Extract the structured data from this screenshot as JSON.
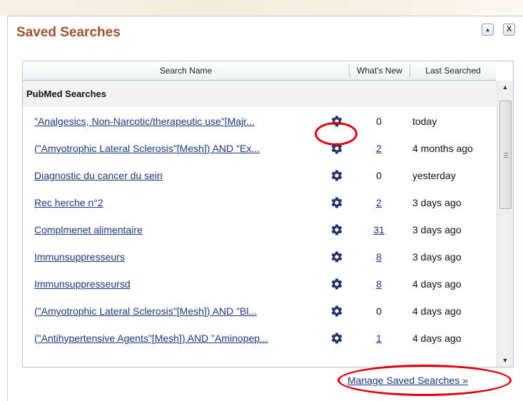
{
  "panel": {
    "title": "Saved Searches",
    "collapse_icon": "triangle-up-icon",
    "close_icon": "close-x-icon",
    "collapse_glyph": "▲",
    "close_glyph": "X"
  },
  "table": {
    "columns": [
      "Search Name",
      "What's New",
      "Last Searched"
    ],
    "group_label": "PubMed Searches",
    "settings_icon": "gear-icon",
    "rows": [
      {
        "name": "\"Analgesics, Non-Narcotic/therapeutic use\"[Majr...",
        "whats_new": "0",
        "whats_new_link": false,
        "last": "today"
      },
      {
        "name": "(\"Amyotrophic Lateral Sclerosis\"[Mesh]) AND \"Ex...",
        "whats_new": "2",
        "whats_new_link": true,
        "last": "4 months ago"
      },
      {
        "name": "Diagnostic du cancer du sein",
        "whats_new": "0",
        "whats_new_link": false,
        "last": "yesterday"
      },
      {
        "name": "Rec herche n°2",
        "whats_new": "2",
        "whats_new_link": true,
        "last": "3 days ago"
      },
      {
        "name": "Complmenet alimentaire",
        "whats_new": "31",
        "whats_new_link": true,
        "last": "3 days ago"
      },
      {
        "name": "Immunsuppresseurs",
        "whats_new": "8",
        "whats_new_link": true,
        "last": "3 days ago"
      },
      {
        "name": "Immunsuppresseursd",
        "whats_new": "8",
        "whats_new_link": true,
        "last": "4 days ago"
      },
      {
        "name": "(\"Amyotrophic Lateral Sclerosis\"[Mesh]) AND \"Bl...",
        "whats_new": "0",
        "whats_new_link": false,
        "last": "4 days ago"
      },
      {
        "name": "(\"Antihypertensive Agents\"[Mesh]) AND \"Aminopep...",
        "whats_new": "1",
        "whats_new_link": true,
        "last": "4 days ago"
      }
    ]
  },
  "footer": {
    "manage_link": "Manage Saved Searches »"
  },
  "colors": {
    "title": "#a0522d",
    "link": "#1a3a7a",
    "highlight": "#e0000f"
  }
}
